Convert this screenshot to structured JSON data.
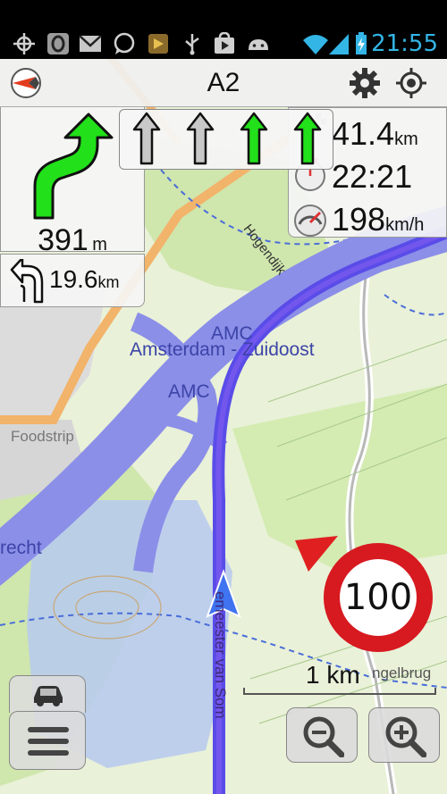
{
  "status_bar": {
    "time": "21:55",
    "icons": [
      "gps-icon",
      "opera-icon",
      "gmail-icon",
      "whatsapp-icon",
      "app-icon",
      "usb-icon",
      "play-store-icon",
      "android-icon",
      "wifi-icon",
      "signal-icon",
      "battery-icon"
    ]
  },
  "top_bar": {
    "road_name": "A2",
    "icons": [
      "compass-icon",
      "gear-icon",
      "my-location-icon"
    ]
  },
  "turn": {
    "distance_value": "391",
    "distance_unit": "m",
    "next_turn_value": "19.6",
    "next_turn_unit": "km",
    "icon": "keep-right-arrow-icon",
    "next_icon": "turn-left-arrow-icon"
  },
  "lanes": {
    "items": [
      {
        "state": "inactive"
      },
      {
        "state": "inactive"
      },
      {
        "state": "active"
      },
      {
        "state": "active"
      }
    ],
    "active_color": "#22e01a",
    "inactive_color": "#c8c8c8"
  },
  "info": {
    "distance_value": "41.4",
    "distance_unit": "km",
    "arrival_time": "22:21",
    "speed_value": "198",
    "speed_unit": "km/h"
  },
  "speed_limit": {
    "value": "100",
    "ring_color": "#d71920"
  },
  "map": {
    "labels": {
      "amc1": "AMC",
      "amsterdam_zuidoost": "Amsterdam - Zuidoost",
      "amc2": "AMC",
      "foodstrip": "Foodstrip",
      "hogendijk": "Hogendijk",
      "utrecht_partial": "recht",
      "burgemeester_partial": "emeester van Som",
      "angelbrug_partial": "ngelbrug"
    },
    "route_color": "#5a4ce8",
    "motorway_color": "#8b8fe8"
  },
  "scale": {
    "label": "1 km"
  },
  "buttons": {
    "menu": "menu-icon",
    "car": "car-icon",
    "zoom_out": "zoom-out-icon",
    "zoom_in": "zoom-in-icon"
  }
}
